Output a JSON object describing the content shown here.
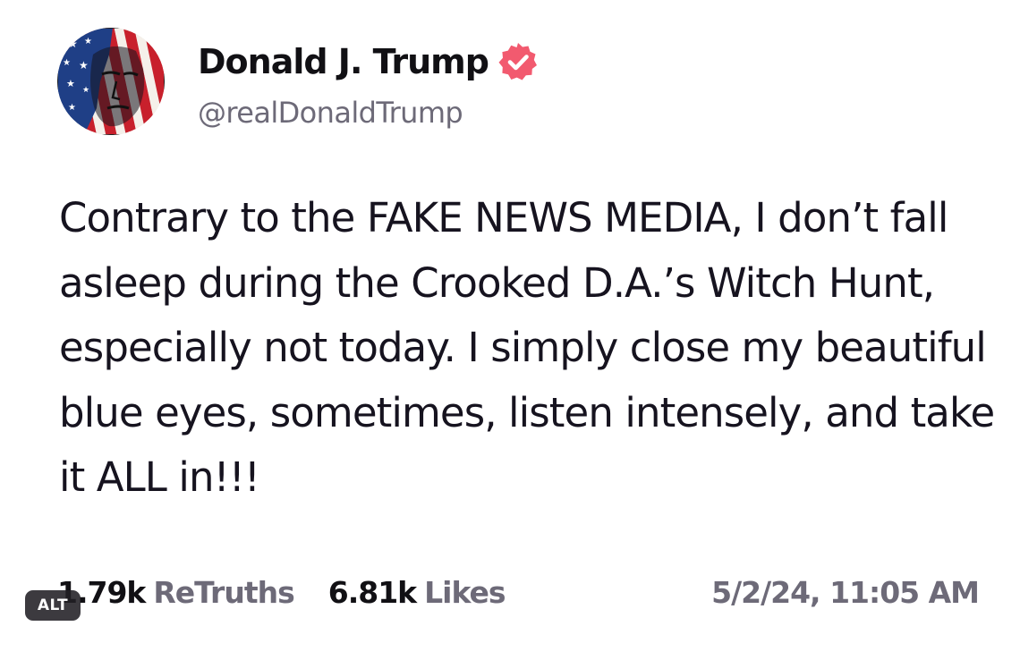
{
  "author": {
    "display_name": "Donald J. Trump",
    "handle": "@realDonaldTrump",
    "avatar_icon": "avatar-portrait-flag",
    "verified_icon": "verified-badge-icon",
    "verified_color": "#f25a6f"
  },
  "post": {
    "text": "Contrary to the FAKE NEWS MEDIA, I don’t fall asleep during the Crooked D.A.’s Witch Hunt, especially not today. I simply close my beautiful blue eyes, sometimes, listen intensely, and take it ALL in!!!"
  },
  "stats": {
    "retruths_count": "1.79k",
    "retruths_label": "ReTruths",
    "likes_count": "6.81k",
    "likes_label": "Likes",
    "timestamp": "5/2/24, 11:05 AM"
  },
  "alt_badge": {
    "label": "ALT"
  },
  "colors": {
    "text_primary": "#16131f",
    "text_secondary": "#6d6a78",
    "background": "#ffffff"
  }
}
